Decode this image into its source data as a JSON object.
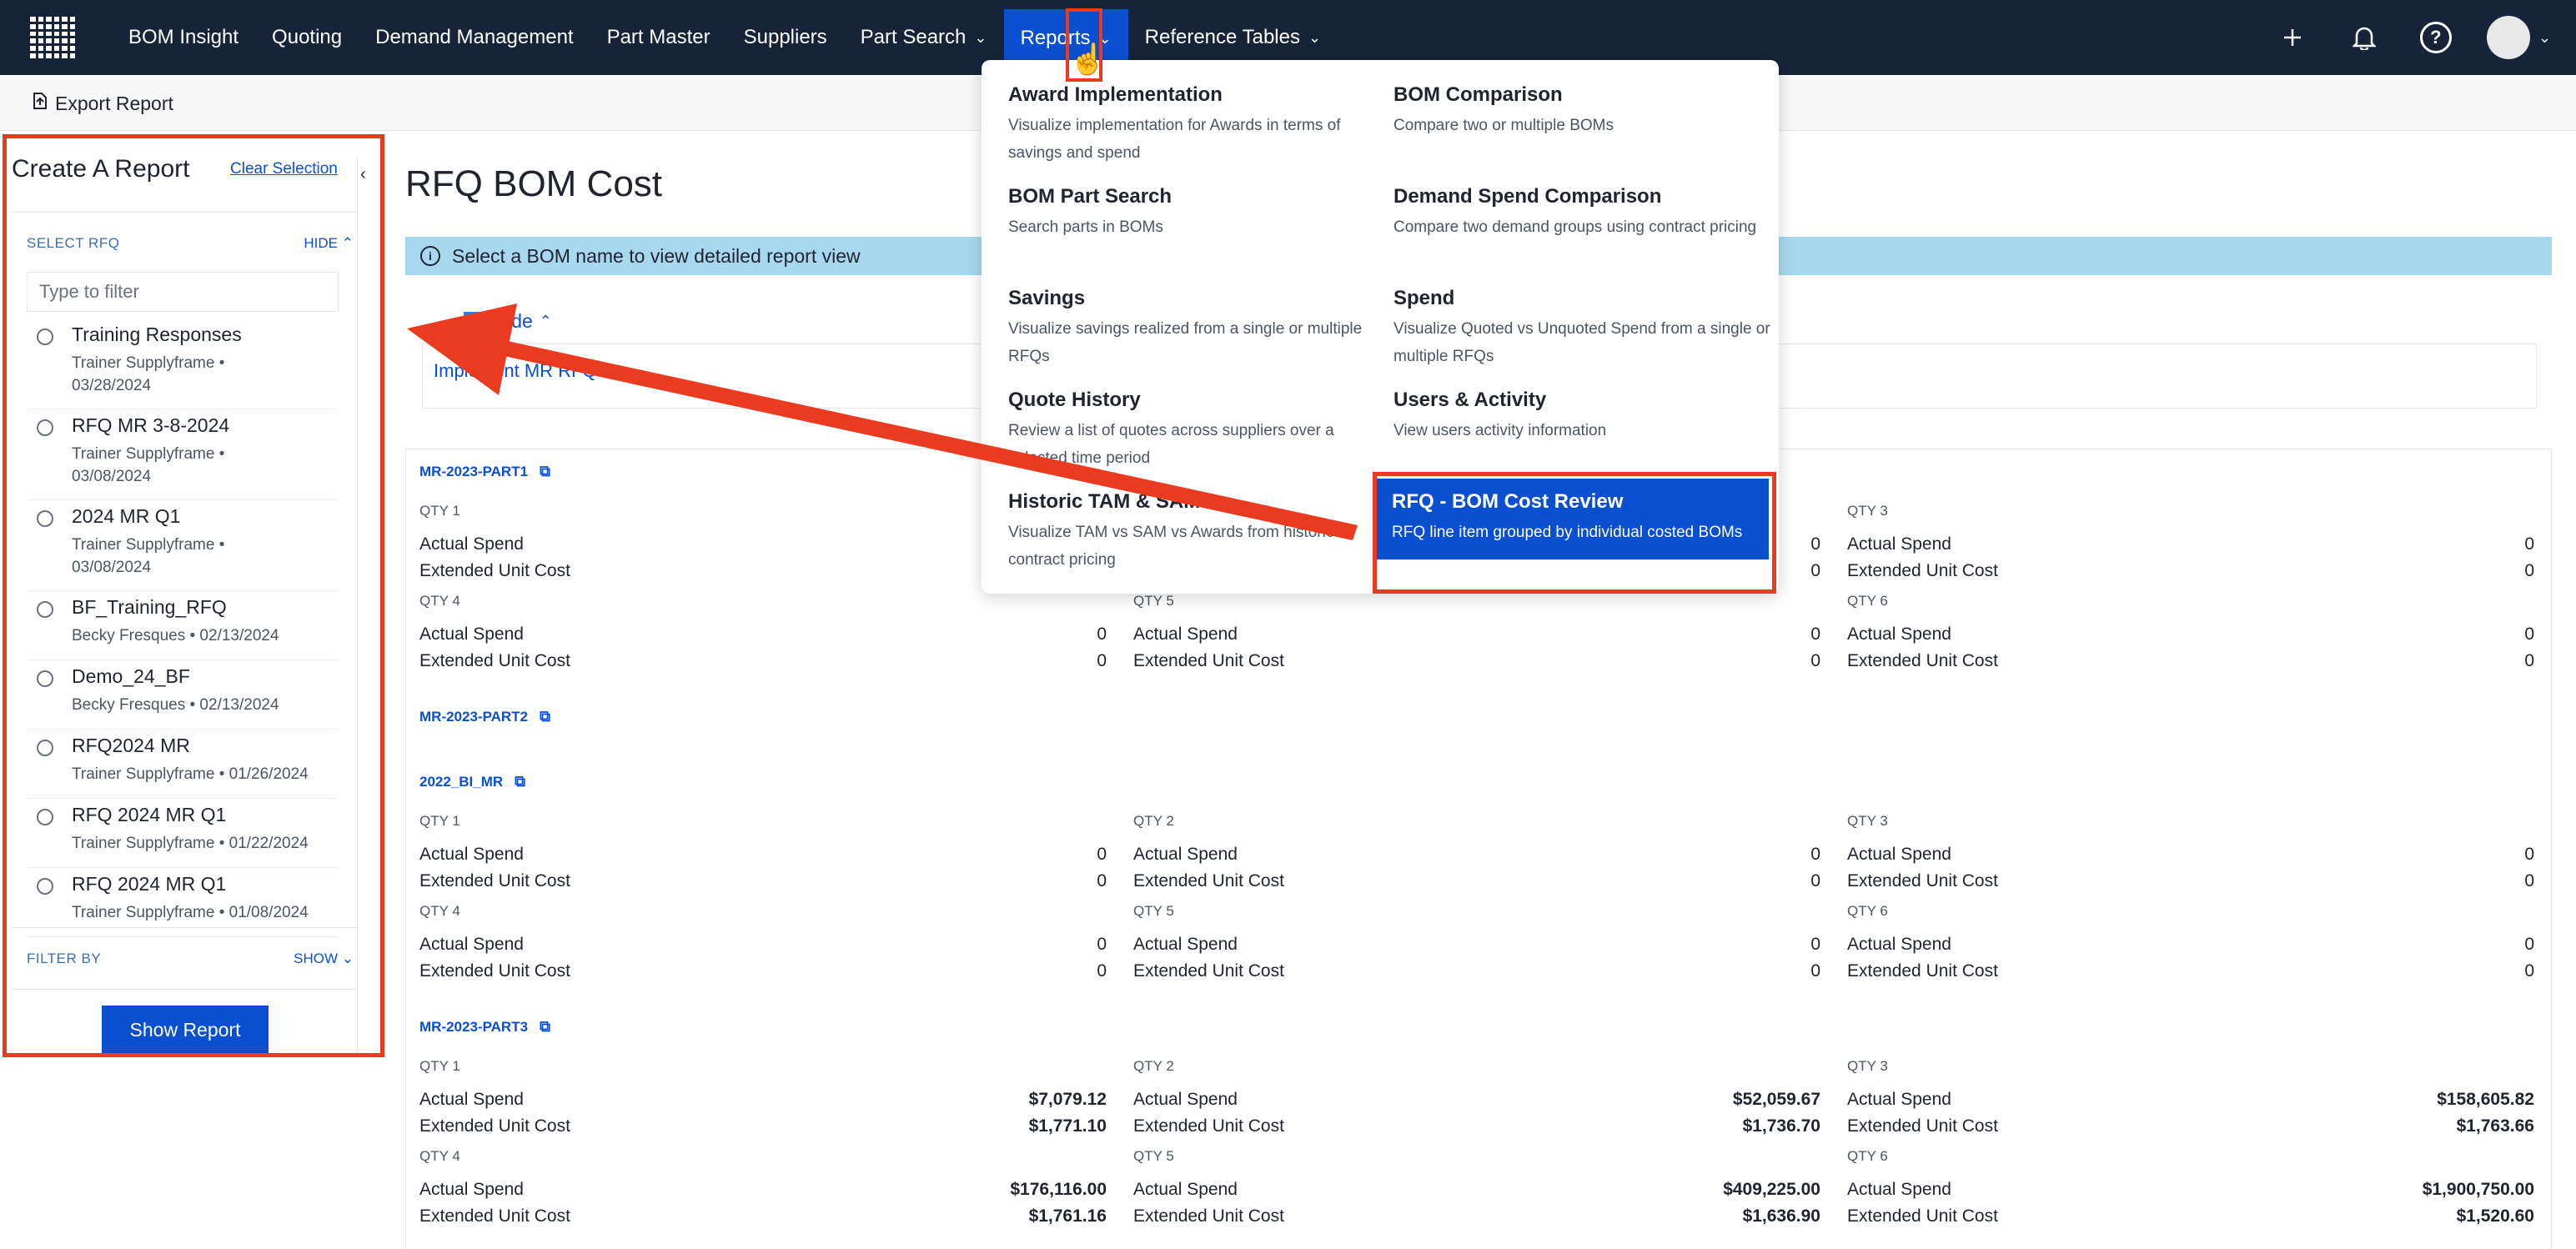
{
  "nav": {
    "items": [
      {
        "label": "BOM Insight"
      },
      {
        "label": "Quoting"
      },
      {
        "label": "Demand Management"
      },
      {
        "label": "Part Master"
      },
      {
        "label": "Suppliers"
      },
      {
        "label": "Part Search",
        "has_chevron": true
      },
      {
        "label": "Reports",
        "has_chevron": true,
        "active": true
      },
      {
        "label": "Reference Tables",
        "has_chevron": true
      }
    ],
    "icons": [
      "plus-icon",
      "bell-icon",
      "help-icon",
      "avatar"
    ],
    "help_glyph": "?"
  },
  "subbar": {
    "export_label": "Export Report"
  },
  "sidebar": {
    "title": "Create A Report",
    "clear_label": "Clear Selection",
    "select_rfq_label": "SELECT RFQ",
    "hide_label": "HIDE",
    "filter_placeholder": "Type to filter",
    "rfqs": [
      {
        "name": "Training Responses",
        "meta": "Trainer Supplyframe • 03/28/2024"
      },
      {
        "name": "RFQ MR 3-8-2024",
        "meta": "Trainer Supplyframe • 03/08/2024"
      },
      {
        "name": "2024 MR Q1",
        "meta": "Trainer Supplyframe • 03/08/2024"
      },
      {
        "name": "BF_Training_RFQ",
        "meta": "Becky Fresques • 02/13/2024"
      },
      {
        "name": "Demo_24_BF",
        "meta": "Becky Fresques • 02/13/2024"
      },
      {
        "name": "RFQ2024 MR",
        "meta": "Trainer Supplyframe • 01/26/2024"
      },
      {
        "name": "RFQ 2024 MR Q1",
        "meta": "Trainer Supplyframe • 01/22/2024"
      },
      {
        "name": "RFQ 2024 MR Q1",
        "meta": "Trainer Supplyframe • 01/08/2024"
      }
    ],
    "filter_by_label": "FILTER BY",
    "show_label": "SHOW",
    "show_report_label": "Show Report"
  },
  "main": {
    "title": "RFQ BOM Cost",
    "banner": "Select a BOM name to view detailed report view",
    "bom_count": "1",
    "bom_toggle": "Hide",
    "bom_link": "Implement MR RFQ",
    "metric_labels": {
      "actual": "Actual Spend",
      "extended": "Extended Unit Cost"
    },
    "parts": [
      {
        "name": "MR-2023-PART1",
        "qtys": [
          {
            "label": "QTY 1",
            "actual": "0",
            "extended": "0"
          },
          {
            "label": "QTY 2",
            "actual": "0",
            "extended": "0"
          },
          {
            "label": "QTY 3",
            "actual": "0",
            "extended": "0"
          },
          {
            "label": "QTY 4",
            "actual": "0",
            "extended": "0"
          },
          {
            "label": "QTY 5",
            "actual": "0",
            "extended": "0"
          },
          {
            "label": "QTY 6",
            "actual": "0",
            "extended": "0"
          }
        ]
      },
      {
        "name": "MR-2023-PART2",
        "qtys": []
      },
      {
        "name": "2022_BI_MR",
        "qtys": [
          {
            "label": "QTY 1",
            "actual": "0",
            "extended": "0"
          },
          {
            "label": "QTY 2",
            "actual": "0",
            "extended": "0"
          },
          {
            "label": "QTY 3",
            "actual": "0",
            "extended": "0"
          },
          {
            "label": "QTY 4",
            "actual": "0",
            "extended": "0"
          },
          {
            "label": "QTY 5",
            "actual": "0",
            "extended": "0"
          },
          {
            "label": "QTY 6",
            "actual": "0",
            "extended": "0"
          }
        ]
      },
      {
        "name": "MR-2023-PART3",
        "qtys": [
          {
            "label": "QTY 1",
            "actual": "$7,079.12",
            "extended": "$1,771.10"
          },
          {
            "label": "QTY 2",
            "actual": "$52,059.67",
            "extended": "$1,736.70"
          },
          {
            "label": "QTY 3",
            "actual": "$158,605.82",
            "extended": "$1,763.66"
          },
          {
            "label": "QTY 4",
            "actual": "$176,116.00",
            "extended": "$1,761.16"
          },
          {
            "label": "QTY 5",
            "actual": "$409,225.00",
            "extended": "$1,636.90"
          },
          {
            "label": "QTY 6",
            "actual": "$1,900,750.00",
            "extended": "$1,520.60"
          }
        ]
      }
    ]
  },
  "reports_menu": {
    "items": [
      {
        "title": "Award Implementation",
        "desc": "Visualize implementation for Awards in terms of savings and spend"
      },
      {
        "title": "BOM Comparison",
        "desc": "Compare two or multiple BOMs"
      },
      {
        "title": "BOM Part Search",
        "desc": "Search parts in BOMs"
      },
      {
        "title": "Demand Spend Comparison",
        "desc": "Compare two demand groups using contract pricing"
      },
      {
        "title": "Savings",
        "desc": "Visualize savings realized from a single or multiple RFQs"
      },
      {
        "title": "Spend",
        "desc": "Visualize Quoted vs Unquoted Spend from a single or multiple RFQs"
      },
      {
        "title": "Quote History",
        "desc": "Review a list of quotes across suppliers over a selected time period"
      },
      {
        "title": "Users & Activity",
        "desc": "View users activity information"
      },
      {
        "title": "Historic TAM & SAM",
        "desc": "Visualize TAM vs SAM vs Awards from historic contract pricing"
      },
      {
        "title": "RFQ - BOM Cost Review",
        "desc": "RFQ line item grouped by individual costed BOMs",
        "highlighted": true
      }
    ]
  },
  "colors": {
    "nav_bg": "#172338",
    "accent": "#0b4fd1",
    "annotation": "#ea3a1f",
    "banner": "#a8d8ef"
  }
}
